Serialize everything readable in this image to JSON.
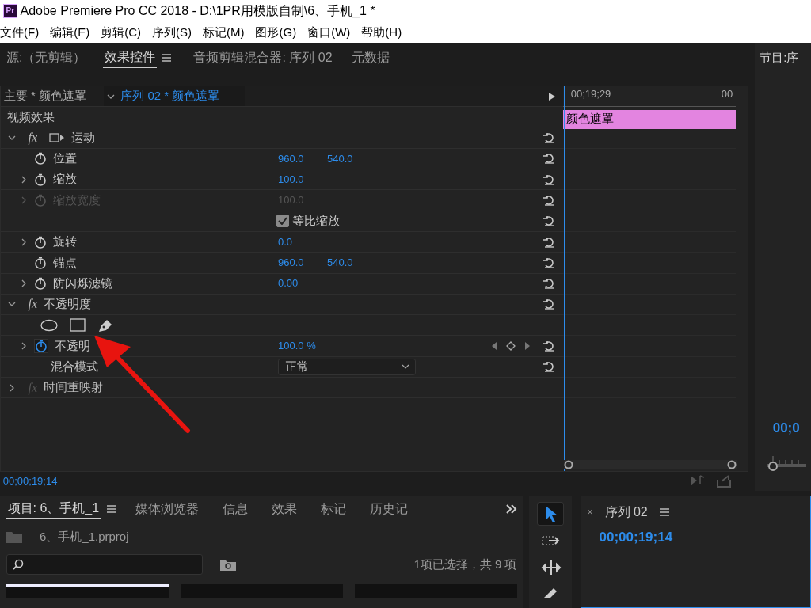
{
  "window": {
    "title": "Adobe Premiere Pro CC 2018 - D:\\1PR用模版自制\\6、手机_1 *",
    "app_icon": "Pr"
  },
  "menu": [
    "文件(F)",
    "编辑(E)",
    "剪辑(C)",
    "序列(S)",
    "标记(M)",
    "图形(G)",
    "窗口(W)",
    "帮助(H)"
  ],
  "panel_tabs": [
    {
      "label": "源:（无剪辑）",
      "selected": false
    },
    {
      "label": "效果控件",
      "selected": true
    },
    {
      "label": "音频剪辑混合器: 序列 02",
      "selected": false
    },
    {
      "label": "元数据",
      "selected": false
    }
  ],
  "program_tab": "节目:序",
  "effect_controls": {
    "master_clip": "主要 * 颜色遮罩",
    "sequence_clip": "序列 02 * 颜色遮罩",
    "section": "视频效果",
    "rows": [
      {
        "kind": "effect",
        "icon_text": "fx",
        "label": "运动",
        "expanded": true,
        "motion_icon": true
      },
      {
        "kind": "property",
        "label": "位置",
        "values": [
          "960.0",
          "540.0"
        ],
        "expandable": false,
        "disabled": false,
        "keyframing": false
      },
      {
        "kind": "property",
        "label": "缩放",
        "values": [
          "100.0"
        ],
        "expandable": true,
        "disabled": false,
        "keyframing": false
      },
      {
        "kind": "property",
        "label": "缩放宽度",
        "values": [
          "100.0"
        ],
        "expandable": true,
        "disabled": true,
        "keyframing": false
      },
      {
        "kind": "checkbox",
        "label": "等比缩放",
        "checked": true
      },
      {
        "kind": "property",
        "label": "旋转",
        "values": [
          "0.0"
        ],
        "expandable": true,
        "disabled": false,
        "keyframing": false
      },
      {
        "kind": "property",
        "label": "锚点",
        "values": [
          "960.0",
          "540.0"
        ],
        "expandable": false,
        "disabled": false,
        "keyframing": false
      },
      {
        "kind": "property",
        "label": "防闪烁滤镜",
        "values": [
          "0.00"
        ],
        "expandable": true,
        "disabled": false,
        "keyframing": false
      },
      {
        "kind": "effect",
        "icon_text": "fx",
        "label": "不透明度",
        "expanded": true
      },
      {
        "kind": "tools"
      },
      {
        "kind": "property",
        "label": "不透明",
        "values": [
          "100.0 %"
        ],
        "expandable": true,
        "disabled": false,
        "keyframing": true
      },
      {
        "kind": "dropdown",
        "label": "混合模式",
        "value": "正常"
      },
      {
        "kind": "effect",
        "icon_text": "fx",
        "label": "时间重映射",
        "expanded": false,
        "disabled": true
      }
    ]
  },
  "timeline": {
    "ruler_start": "00;19;29",
    "ruler_end": "00",
    "clip": "颜色遮罩"
  },
  "current_time": "00;00;19;14",
  "program_timecode": "00;0",
  "project_tabs": [
    {
      "label": "项目: 6、手机_1",
      "selected": true
    },
    {
      "label": "媒体浏览器",
      "selected": false
    },
    {
      "label": "信息",
      "selected": false
    },
    {
      "label": "效果",
      "selected": false
    },
    {
      "label": "标记",
      "selected": false
    },
    {
      "label": "历史记",
      "selected": false
    }
  ],
  "project_file": "6、手机_1.prproj",
  "selection_info": "1项已选择，共 9 项",
  "tools": [
    {
      "kind": "select",
      "selected": true
    },
    {
      "kind": "track",
      "selected": false
    },
    {
      "kind": "ripple",
      "selected": false
    },
    {
      "kind": "razor",
      "selected": false
    }
  ],
  "sequence": {
    "close": "×",
    "tab": "序列 02",
    "timecode": "00;00;19;14"
  }
}
